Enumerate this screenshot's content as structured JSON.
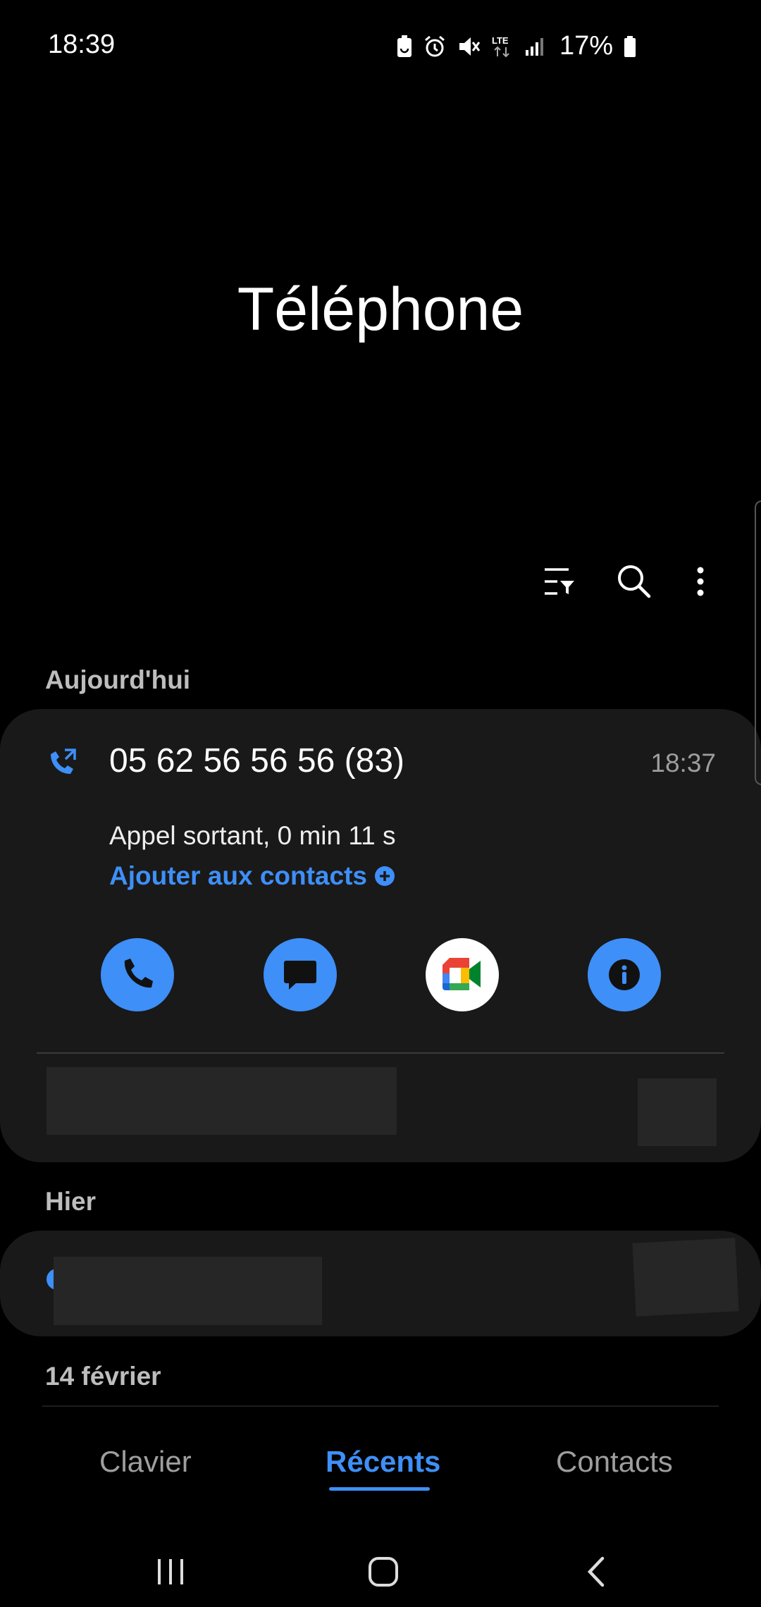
{
  "status": {
    "time": "18:39",
    "battery": "17%",
    "network": "LTE"
  },
  "app": {
    "title": "Téléphone"
  },
  "toolbar": {
    "icons": [
      "filter-icon",
      "search-icon",
      "more-icon"
    ]
  },
  "sections": {
    "today": "Aujourd'hui",
    "yesterday": "Hier",
    "older": "14 février"
  },
  "call": {
    "number": "05 62 56 56 56 (83)",
    "time": "18:37",
    "detail": "Appel sortant, 0 min 11 s",
    "add_contact": "Ajouter aux contacts"
  },
  "actions": [
    "phone-icon",
    "message-icon",
    "google-meet-icon",
    "info-icon"
  ],
  "tabs": {
    "keypad": "Clavier",
    "recents": "Récents",
    "contacts": "Contacts"
  },
  "colors": {
    "accent": "#3e8ff7",
    "card": "#191919",
    "background": "#000000"
  }
}
